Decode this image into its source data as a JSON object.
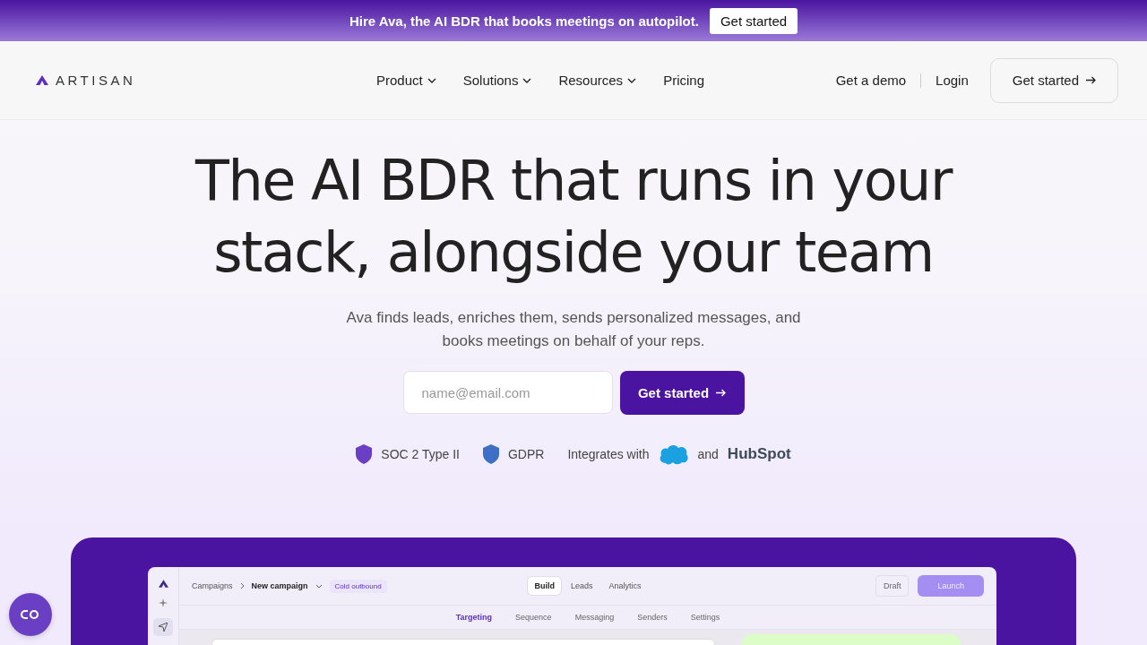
{
  "banner": {
    "text": "Hire Ava, the AI BDR that books meetings on autopilot.",
    "button": "Get started"
  },
  "nav": {
    "brand": "ARTISAN",
    "items": [
      {
        "label": "Product",
        "dropdown": true
      },
      {
        "label": "Solutions",
        "dropdown": true
      },
      {
        "label": "Resources",
        "dropdown": true
      },
      {
        "label": "Pricing",
        "dropdown": false
      }
    ],
    "demo": "Get a demo",
    "login": "Login",
    "cta": "Get started"
  },
  "hero": {
    "title_line_1": "The AI BDR that runs in your",
    "title_line_2": "stack, alongside your team",
    "subtitle": "Ava finds leads, enriches them, sends personalized messages, and books meetings on behalf of your reps.",
    "email_placeholder": "name@email.com",
    "cta": "Get started"
  },
  "trust": {
    "badges": [
      {
        "label": "SOC 2 Type II",
        "color": "#6a3fc4"
      },
      {
        "label": "GDPR",
        "color": "#3f6fc4"
      }
    ],
    "integrates": "Integrates with",
    "and": "and",
    "hubspot": "HubSpot"
  },
  "app": {
    "breadcrumb_root": "Campaigns",
    "campaign": "New campaign",
    "tag": "Cold outbound",
    "views": [
      {
        "label": "Build",
        "selected": true
      },
      {
        "label": "Leads",
        "selected": false
      },
      {
        "label": "Analytics",
        "selected": false
      }
    ],
    "draft": "Draft",
    "launch": "Launch",
    "steps": [
      {
        "label": "Targeting",
        "selected": true
      },
      {
        "label": "Sequence",
        "selected": false
      },
      {
        "label": "Messaging",
        "selected": false
      },
      {
        "label": "Senders",
        "selected": false
      },
      {
        "label": "Settings",
        "selected": false
      }
    ]
  }
}
